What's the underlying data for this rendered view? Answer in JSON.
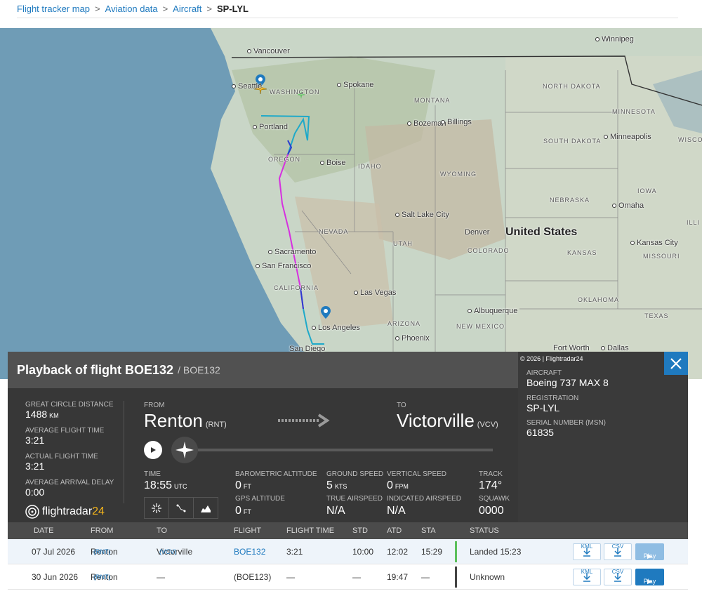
{
  "breadcrumb": {
    "items": [
      "Flight tracker map",
      "Aviation data",
      "Aircraft"
    ],
    "separator": ">",
    "current": "SP-LYL"
  },
  "map": {
    "labels": {
      "vancouver": "Vancouver",
      "seattle": "Seattle",
      "spokane": "Spokane",
      "portland": "Portland",
      "washington": "WASHINGTON",
      "oregon": "OREGON",
      "idaho": "IDAHO",
      "montana": "MONTANA",
      "bozeman": "Bozeman",
      "billings": "Billings",
      "wyoming": "WYOMING",
      "boise": "Boise",
      "nevada": "NEVADA",
      "utah": "UTAH",
      "salt_lake": "Salt Lake City",
      "colorado": "COLORADO",
      "denver": "Denver",
      "california": "CALIFORNIA",
      "sacramento": "Sacramento",
      "san_francisco": "San Francisco",
      "las_vegas": "Las Vegas",
      "los_angeles": "Los Angeles",
      "san_diego": "San Diego",
      "arizona": "ARIZONA",
      "phoenix": "Phoenix",
      "new_mexico": "NEW MEXICO",
      "albuquerque": "Albuquerque",
      "north_dakota": "NORTH DAKOTA",
      "south_dakota": "SOUTH DAKOTA",
      "nebraska": "NEBRASKA",
      "kansas": "KANSAS",
      "oklahoma": "OKLAHOMA",
      "minnesota": "MINNESOTA",
      "iowa": "IOWA",
      "missouri": "MISSOURI",
      "winnipeg": "Winnipeg",
      "minneapolis": "Minneapolis",
      "omaha": "Omaha",
      "kansas_city": "Kansas City",
      "fort_worth": "Fort Worth",
      "dallas": "Dallas",
      "united_states": "United States",
      "texas": "TEXAS",
      "illi": "ILLI",
      "wisco": "WISCO"
    }
  },
  "playback": {
    "title": "Playback of flight BOE132",
    "subtitle": "/ BOE132",
    "copyright": "© 2026 | Flightradar24",
    "stats": [
      {
        "label": "GREAT CIRCLE DISTANCE",
        "value": "1488",
        "unit": "KM"
      },
      {
        "label": "AVERAGE FLIGHT TIME",
        "value": "3:21",
        "unit": ""
      },
      {
        "label": "ACTUAL FLIGHT TIME",
        "value": "3:21",
        "unit": ""
      },
      {
        "label": "AVERAGE ARRIVAL DELAY",
        "value": "0:00",
        "unit": ""
      }
    ],
    "from_label": "FROM",
    "from_city": "Renton",
    "from_code": "(RNT)",
    "to_label": "TO",
    "to_city": "Victorville",
    "to_code": "(VCV)",
    "time_label": "TIME",
    "time_value": "18:55",
    "time_unit": "UTC",
    "baro_label": "BAROMETRIC ALTITUDE",
    "baro_value": "0",
    "baro_unit": "FT",
    "gps_label": "GPS ALTITUDE",
    "gps_value": "0",
    "gps_unit": "FT",
    "gs_label": "GROUND SPEED",
    "gs_value": "5",
    "gs_unit": "KTS",
    "tas_label": "TRUE AIRSPEED",
    "tas_value": "N/A",
    "vs_label": "VERTICAL SPEED",
    "vs_value": "0",
    "vs_unit": "FPM",
    "ias_label": "INDICATED AIRSPEED",
    "ias_value": "N/A",
    "track_label": "TRACK",
    "track_value": "174°",
    "squawk_label": "SQUAWK",
    "squawk_value": "0000",
    "logo_text": "flightradar",
    "logo_num": "24",
    "aircraft_label": "AIRCRAFT",
    "aircraft_value": "Boeing 737 MAX 8",
    "registration_label": "REGISTRATION",
    "registration_value": "SP-LYL",
    "serial_label": "SERIAL NUMBER (MSN)",
    "serial_value": "61835"
  },
  "table": {
    "headers": [
      "DATE",
      "FROM",
      "TO",
      "FLIGHT",
      "FLIGHT TIME",
      "STD",
      "ATD",
      "STA",
      "STATUS"
    ],
    "rows": [
      {
        "date": "07 Jul 2026",
        "from": "Renton",
        "from_code": "(RNT)",
        "to": "Victorville",
        "to_code": "(VCV)",
        "flight": "BOE132",
        "flight_time": "3:21",
        "std": "10:00",
        "atd": "12:02",
        "sta": "15:29",
        "status": "Landed 15:23",
        "status_color": "#5cc05c"
      },
      {
        "date": "30 Jun 2026",
        "from": "Renton",
        "from_code": "(RNT)",
        "to": "—",
        "to_code": "",
        "flight": "(BOE123)",
        "flight_time": "—",
        "std": "—",
        "atd": "19:47",
        "sta": "—",
        "status": "Unknown",
        "status_color": "#444444"
      }
    ],
    "kml_label": "KML",
    "csv_label": "CSV",
    "play_label": "Play"
  },
  "colors": {
    "accent": "#1f7abf",
    "logo_accent": "#f5b51b",
    "landed": "#5cc05c"
  }
}
